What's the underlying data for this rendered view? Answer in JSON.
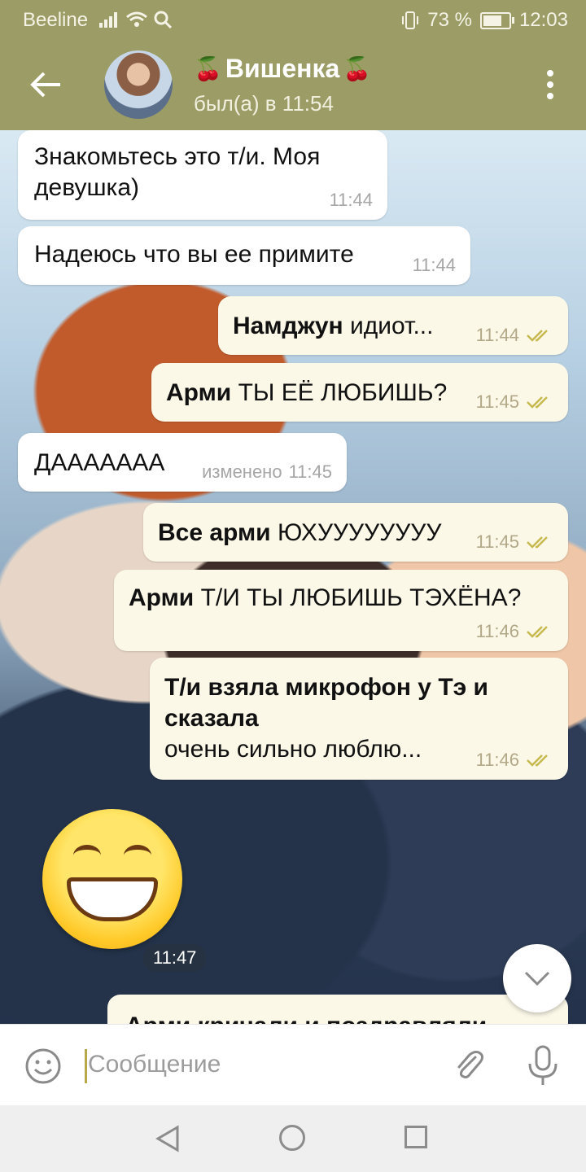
{
  "status_bar": {
    "carrier": "Beeline",
    "battery": "73 %",
    "battery_level": 0.73,
    "time": "12:03"
  },
  "header": {
    "back_icon": "arrow-left-icon",
    "contact_name": "Вишенка",
    "decoration_emoji": "🍒",
    "last_seen": "был(а) в 11:54",
    "menu_icon": "more-vertical-icon"
  },
  "messages": [
    {
      "direction": "in",
      "text": "Знакомьтесь это т/и. Моя девушка)",
      "time": "11:44"
    },
    {
      "direction": "in",
      "text": "Надеюсь что вы ее примите",
      "time": "11:44"
    },
    {
      "direction": "out",
      "bold": "Намджун",
      "text": "идиот...",
      "time": "11:44"
    },
    {
      "direction": "out",
      "bold": "Арми",
      "text": "ТЫ ЕЁ ЛЮБИШЬ?",
      "time": "11:45"
    },
    {
      "direction": "in",
      "text": "ДАААААAA",
      "time": "11:45",
      "edited_label": "изменено"
    },
    {
      "direction": "out",
      "bold": "Все арми",
      "text": "ЮХУУУУУУУУ",
      "time": "11:45"
    },
    {
      "direction": "out",
      "bold": "Арми",
      "text": "Т/И ТЫ ЛЮБИШЬ ТЭХЁНА?",
      "time": "11:46"
    },
    {
      "direction": "out",
      "bold": "Т/и взяла микрофон у Тэ и сказала",
      "text": "очень сильно люблю...",
      "time": "11:46"
    }
  ],
  "sticker": {
    "icon": "grinning-face-emoji",
    "time": "11:47"
  },
  "partial_message": "Арми кричали и поздравляли",
  "scroll_down_icon": "chevron-down-icon",
  "input": {
    "placeholder": "Сообщение",
    "emoji_icon": "smile-icon",
    "attach_icon": "paperclip-icon",
    "mic_icon": "microphone-icon"
  },
  "colors": {
    "header": "#9c9c67",
    "outgoing_bubble": "#fbf8e8",
    "incoming_bubble": "#ffffff",
    "read_check": "#c7b94e"
  }
}
